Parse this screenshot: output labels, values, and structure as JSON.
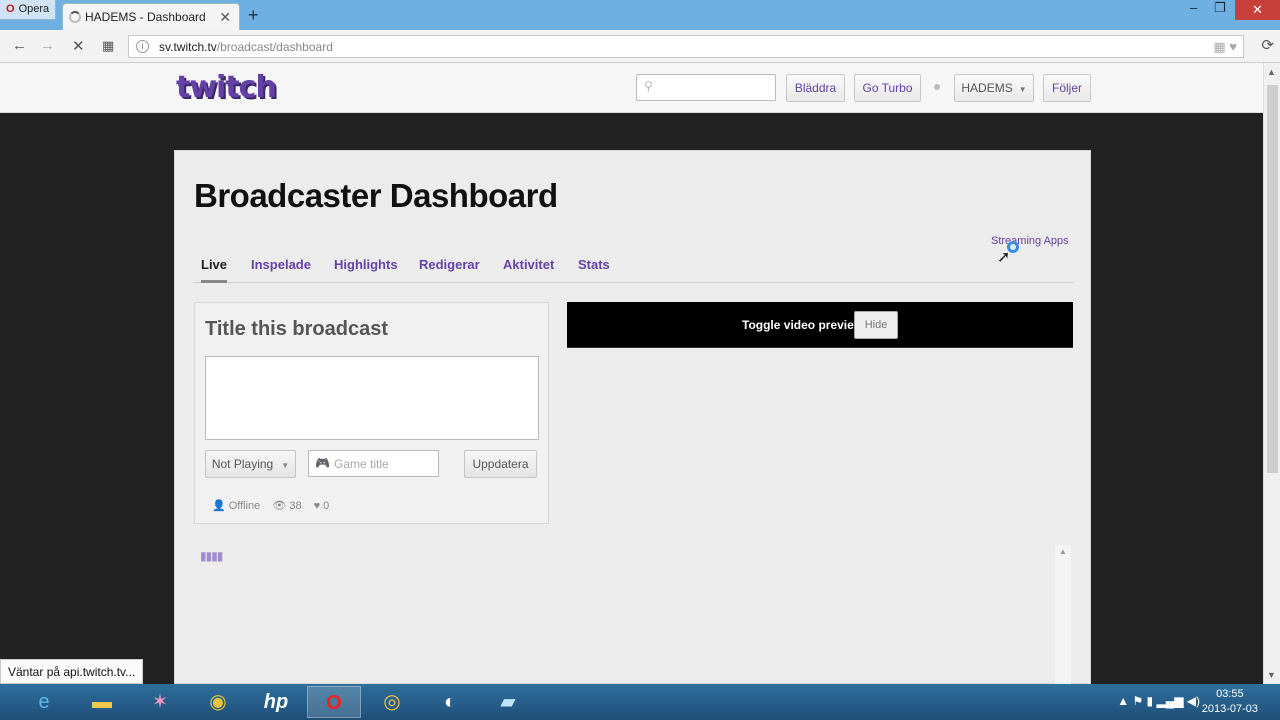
{
  "browser": {
    "opera_label": "Opera",
    "tab_title": "HADEMS - Dashboard",
    "new_tab": "+",
    "url_host": "sv.twitch.tv",
    "url_path": "/broadcast/dashboard"
  },
  "twitch": {
    "logo": "twitch",
    "nav": {
      "browse": "Bläddra",
      "turbo": "Go Turbo",
      "user": "HADEMS",
      "following": "Följer"
    }
  },
  "dashboard": {
    "title": "Broadcaster Dashboard",
    "streaming_apps": "Streaming Apps",
    "tabs": [
      "Live",
      "Inspelade",
      "Highlights",
      "Redigerar",
      "Aktivitet",
      "Stats"
    ],
    "broadcast": {
      "heading": "Title this broadcast",
      "title_value": "",
      "playing_select": "Not Playing",
      "game_placeholder": "Game title",
      "update_button": "Uppdatera",
      "status": "Offline",
      "viewers": "38",
      "followers": "0"
    },
    "video": {
      "toggle_label": "Toggle video preview:",
      "hide_button": "Hide"
    }
  },
  "status_bar": "Väntar på api.twitch.tv...",
  "taskbar": {
    "time": "03:55",
    "date": "2013-07-03"
  }
}
